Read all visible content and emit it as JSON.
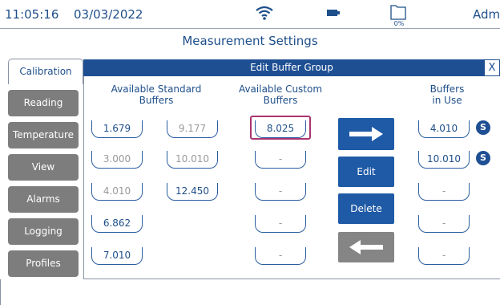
{
  "status": {
    "time": "11:05:16",
    "date": "03/03/2022",
    "storage_pct": "0%",
    "user": "Admin",
    "icons": [
      "wifi-icon",
      "battery-icon",
      "folder-icon"
    ]
  },
  "page_title": "Measurement Settings",
  "nav": {
    "active_tab": "Calibration",
    "items": [
      "Reading",
      "Temperature",
      "View",
      "Alarms",
      "Logging",
      "Profiles"
    ]
  },
  "panel": {
    "title": "Edit Buffer Group",
    "close_label": "X",
    "col_standard": {
      "line1": "Available Standard",
      "line2": "Buffers"
    },
    "col_custom": {
      "line1": "Available Custom",
      "line2": "Buffers"
    },
    "col_in_use": {
      "line1": "Buffers",
      "line2": "in Use"
    },
    "standard_col1": [
      "1.679",
      "3.000",
      "4.010",
      "6.862",
      "7.010"
    ],
    "standard_col2": [
      "9.177",
      "10.010",
      "12.450"
    ],
    "custom": [
      "8.025",
      "-",
      "-",
      "-",
      "-"
    ],
    "in_use": [
      "4.010",
      "10.010",
      "-",
      "-",
      "-"
    ],
    "in_use_badge": "S",
    "buttons": {
      "edit": "Edit",
      "delete": "Delete"
    }
  },
  "colors": {
    "accent": "#1f4f93",
    "selected_border": "#a8356f",
    "nav_gray": "#7d7d7d",
    "disabled_gray": "#858585"
  }
}
